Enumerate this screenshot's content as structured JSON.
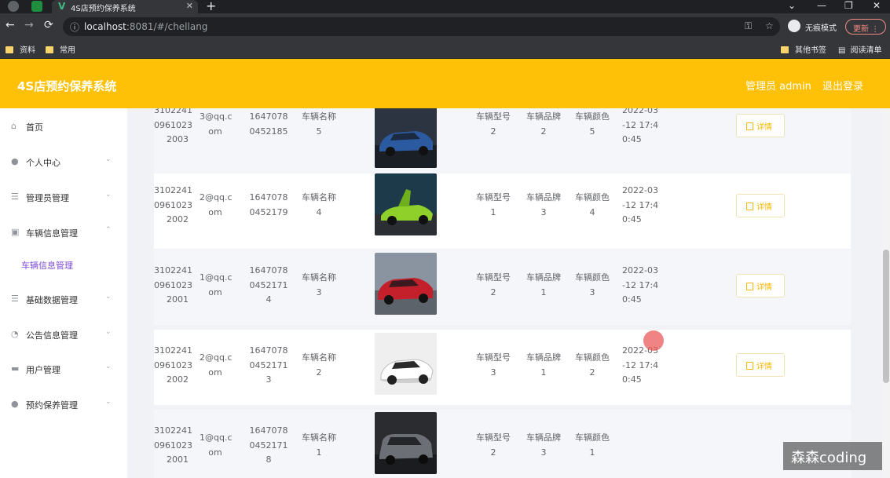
{
  "browser": {
    "tab_title": "4S店预约保养系统",
    "url_host": "localhost",
    "url_rest": ":8081/#/chellang",
    "incognito_label": "无痕模式",
    "update_label": "更新",
    "bookmarks": [
      "资料",
      "常用"
    ],
    "bookmarks_right": [
      "其他书签",
      "阅读清单"
    ]
  },
  "header": {
    "title": "4S店预约保养系统",
    "user_label": "管理员 admin",
    "logout_label": "退出登录",
    "accent": "#ffc107"
  },
  "sidebar": {
    "items": [
      {
        "label": "首页",
        "icon": "home-icon"
      },
      {
        "label": "个人中心",
        "icon": "person-icon"
      },
      {
        "label": "管理员管理",
        "icon": "list-icon"
      },
      {
        "label": "车辆信息管理",
        "icon": "clipboard-icon"
      },
      {
        "label": "基础数据管理",
        "icon": "list-icon"
      },
      {
        "label": "公告信息管理",
        "icon": "gauge-icon"
      },
      {
        "label": "用户管理",
        "icon": "user-card-icon"
      },
      {
        "label": "预约保养管理",
        "icon": "bulb-icon"
      }
    ],
    "active_sub": "车辆信息管理",
    "active_color": "#7b4ad6"
  },
  "table": {
    "detail_label": "详情",
    "rows": [
      {
        "acct": [
          "3102241",
          "0961023",
          "2003"
        ],
        "mail": [
          "3@qq.c",
          "om"
        ],
        "phone": [
          "1647078",
          "0452185"
        ],
        "name": [
          "车辆名称",
          "5"
        ],
        "type": [
          "车辆型号",
          "2"
        ],
        "brand": [
          "车辆品牌",
          "2"
        ],
        "color": [
          "车辆颜色",
          "5"
        ],
        "time": [
          "2022-03",
          "-12 17:4",
          "0:45"
        ],
        "car": "blue"
      },
      {
        "acct": [
          "3102241",
          "0961023",
          "2002"
        ],
        "mail": [
          "2@qq.c",
          "om"
        ],
        "phone": [
          "1647078",
          "0452179"
        ],
        "name": [
          "车辆名称",
          "4"
        ],
        "type": [
          "车辆型号",
          "1"
        ],
        "brand": [
          "车辆品牌",
          "3"
        ],
        "color": [
          "车辆颜色",
          "4"
        ],
        "time": [
          "2022-03",
          "-12 17:4",
          "0:45"
        ],
        "car": "green"
      },
      {
        "acct": [
          "3102241",
          "0961023",
          "2001"
        ],
        "mail": [
          "1@qq.c",
          "om"
        ],
        "phone": [
          "1647078",
          "0452171",
          "4"
        ],
        "name": [
          "车辆名称",
          "3"
        ],
        "type": [
          "车辆型号",
          "2"
        ],
        "brand": [
          "车辆品牌",
          "1"
        ],
        "color": [
          "车辆颜色",
          "3"
        ],
        "time": [
          "2022-03",
          "-12 17:4",
          "0:45"
        ],
        "car": "red"
      },
      {
        "acct": [
          "3102241",
          "0961023",
          "2002"
        ],
        "mail": [
          "2@qq.c",
          "om"
        ],
        "phone": [
          "1647078",
          "0452171",
          "3"
        ],
        "name": [
          "车辆名称",
          "2"
        ],
        "type": [
          "车辆型号",
          "3"
        ],
        "brand": [
          "车辆品牌",
          "1"
        ],
        "color": [
          "车辆颜色",
          "2"
        ],
        "time": [
          "2022-03",
          "-12 17:4",
          "0:45"
        ],
        "car": "white"
      },
      {
        "acct": [
          "3102241",
          "0961023",
          "2001"
        ],
        "mail": [
          "1@qq.c",
          "om"
        ],
        "phone": [
          "1647078",
          "0452171",
          "8"
        ],
        "name": [
          "车辆名称",
          "1"
        ],
        "type": [
          "车辆型号",
          "2"
        ],
        "brand": [
          "车辆品牌",
          "3"
        ],
        "color": [
          "车辆颜色",
          "1"
        ],
        "time": [
          "",
          "",
          ""
        ],
        "car": "gray"
      }
    ]
  },
  "watermark": "森森coding"
}
